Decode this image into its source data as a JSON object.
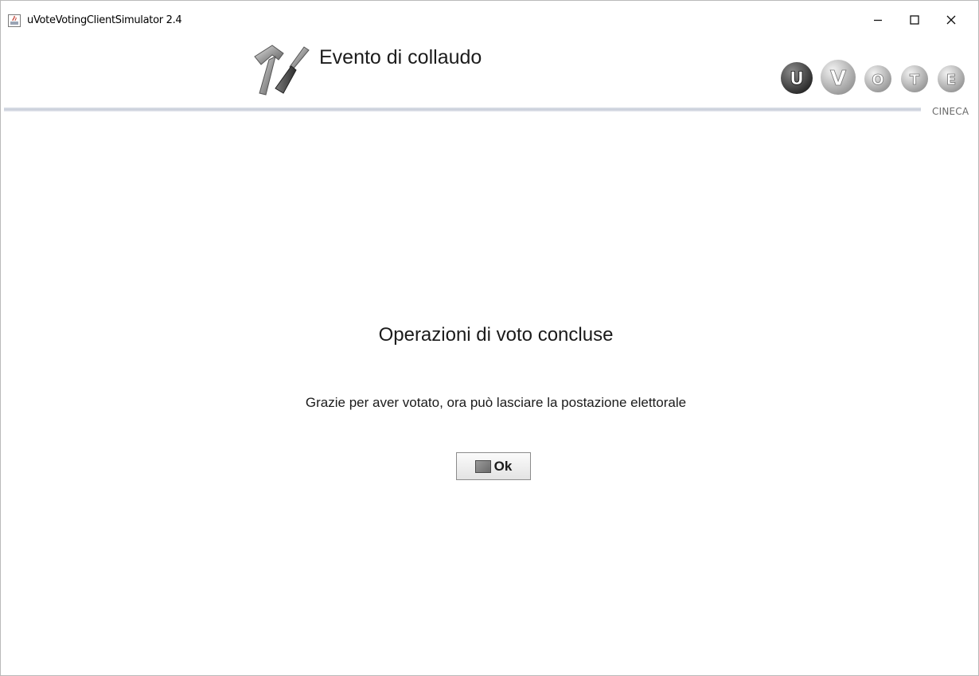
{
  "window": {
    "title": "uVoteVotingClientSimulator 2.4",
    "controls": {
      "minimize": "minimize-icon",
      "maximize": "maximize-icon",
      "close": "close-icon"
    }
  },
  "header": {
    "event_title": "Evento di collaudo",
    "event_icon": "hammer-screwdriver-icon",
    "logo": {
      "letters": [
        "U",
        "V",
        "O",
        "T",
        "E"
      ],
      "caption": "CINECA"
    }
  },
  "main": {
    "heading": "Operazioni di voto concluse",
    "message": "Grazie per aver votato, ora può lasciare la postazione elettorale",
    "ok_button": {
      "label": "Ok",
      "icon": "square-icon"
    }
  },
  "colors": {
    "text": "#1b1b1b",
    "rule": "#c8ceda",
    "logo_dark": "#3a3a3a",
    "logo_light": "#b5b5b5"
  }
}
